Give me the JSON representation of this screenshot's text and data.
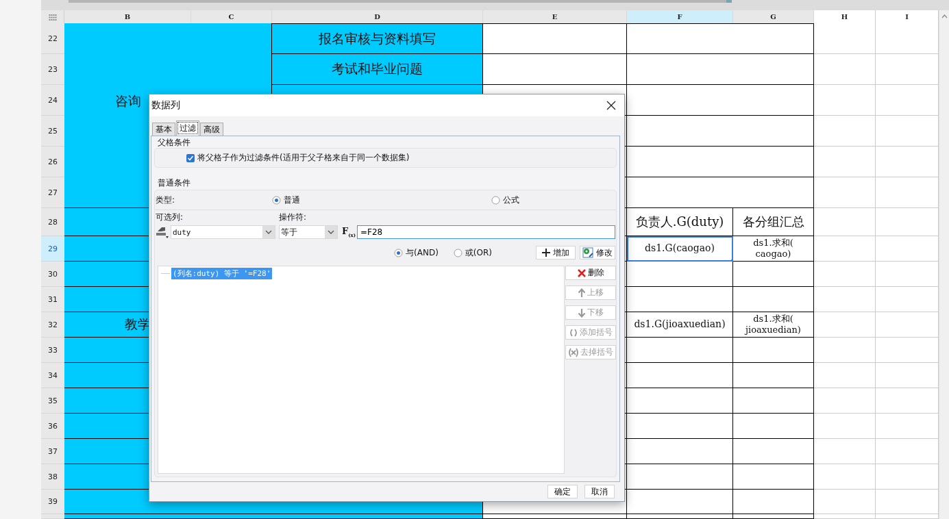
{
  "sheet": {
    "columns": [
      {
        "label": "B",
        "selected": false
      },
      {
        "label": "C",
        "selected": false
      },
      {
        "label": "D",
        "selected": false
      },
      {
        "label": "E",
        "selected": false
      },
      {
        "label": "F",
        "selected": true
      },
      {
        "label": "G",
        "selected": false
      },
      {
        "label": "H",
        "selected": false
      },
      {
        "label": "I",
        "selected": false
      }
    ],
    "rows": [
      {
        "label": "22",
        "selected": false
      },
      {
        "label": "23",
        "selected": false
      },
      {
        "label": "24",
        "selected": false
      },
      {
        "label": "25",
        "selected": false
      },
      {
        "label": "26",
        "selected": false
      },
      {
        "label": "27",
        "selected": false
      },
      {
        "label": "28",
        "selected": false
      },
      {
        "label": "29",
        "selected": true
      },
      {
        "label": "30",
        "selected": false
      },
      {
        "label": "31",
        "selected": false
      },
      {
        "label": "32",
        "selected": false
      },
      {
        "label": "33",
        "selected": false
      },
      {
        "label": "34",
        "selected": false
      },
      {
        "label": "35",
        "selected": false
      },
      {
        "label": "36",
        "selected": false
      },
      {
        "label": "37",
        "selected": false
      },
      {
        "label": "38",
        "selected": false
      },
      {
        "label": "39",
        "selected": false
      }
    ],
    "cells": [
      {
        "text": "咨询",
        "selected": false
      },
      {
        "text": "报名审核与资料填写",
        "selected": false
      },
      {
        "text": "考试和毕业问题",
        "selected": false
      },
      {
        "text": "教学",
        "selected": false
      },
      {
        "text": "负责人.G(duty)",
        "selected": false
      },
      {
        "text": "各分组汇总",
        "selected": false
      },
      {
        "text": "ds1.G(caogao)",
        "selected": true
      },
      {
        "text": "ds1.求和(\ncaogao)",
        "selected": false
      },
      {
        "text": "ds1.G(jioaxuedian)",
        "selected": false
      },
      {
        "text": "ds1.求和(\njioaxuedian)",
        "selected": false
      }
    ]
  },
  "dialog": {
    "title": "数据列",
    "tabs": [
      {
        "label": "基本",
        "selected": false
      },
      {
        "label": "过滤",
        "selected": true
      },
      {
        "label": "高级",
        "selected": false
      }
    ],
    "parent_condition": {
      "title": "父格条件",
      "checkbox": {
        "label": "将父格子作为过滤条件(适用于父子格来自于同一个数据集)",
        "checked": true
      }
    },
    "normal_condition": {
      "title": "普通条件",
      "type_label": "类型:",
      "type_options": [
        {
          "label": "普通",
          "selected": true
        },
        {
          "label": "公式",
          "selected": false
        }
      ],
      "column_label": "可选列:",
      "column_value": "duty",
      "operator_label": "操作符:",
      "operator_value": "等于",
      "formula_label": "F$_{(x)}$",
      "formula_value": "=F28",
      "logic_options": [
        {
          "label": "与(AND)",
          "selected": true
        },
        {
          "label": "或(OR)",
          "selected": false
        }
      ],
      "add_button": "增加",
      "modify_button": "修改",
      "conditions": [
        {
          "text": "(列名:duty) 等于 '=F28'",
          "selected": true
        }
      ],
      "side_buttons": [
        {
          "label": "删除",
          "kind": "delete",
          "disabled": false
        },
        {
          "label": "上移",
          "kind": "up",
          "disabled": true
        },
        {
          "label": "下移",
          "kind": "down",
          "disabled": true
        },
        {
          "label": "添加括号",
          "kind": "add-bracket",
          "disabled": true
        },
        {
          "label": "去掉括号",
          "kind": "remove-bracket",
          "disabled": true
        }
      ]
    },
    "buttons": [
      "确定",
      "取消"
    ]
  }
}
